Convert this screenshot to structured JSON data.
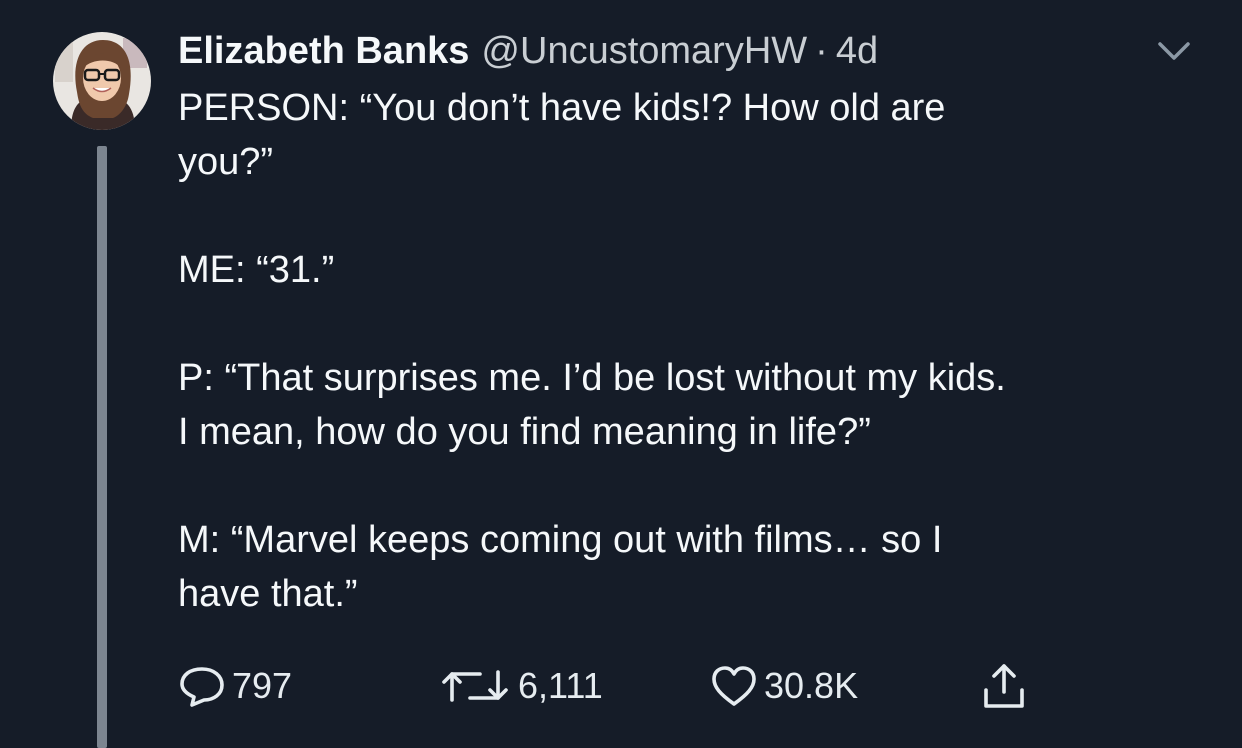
{
  "tweet": {
    "author_name": "Elizabeth Banks",
    "handle": "@UncustomaryHW",
    "separator": "·",
    "time": "4d",
    "lines": [
      "PERSON: “You don’t have kids!? How old are\nyou?”",
      "ME: “31.”",
      "P: “That surprises me. I’d be lost without my kids.\nI mean, how do you find meaning in life?”",
      "M: “Marvel keeps coming out with films… so I\nhave that.”"
    ],
    "stats": {
      "replies": "797",
      "retweets": "6,111",
      "likes": "30.8K"
    }
  },
  "icons": {
    "menu": "chevron-down-icon",
    "reply": "reply-icon",
    "retweet": "retweet-icon",
    "like": "heart-icon",
    "share": "share-icon"
  },
  "colors": {
    "background": "#151c28",
    "text": "#f5f8fa",
    "secondary_text": "#c9ced3",
    "thread_line": "#7c8590"
  }
}
